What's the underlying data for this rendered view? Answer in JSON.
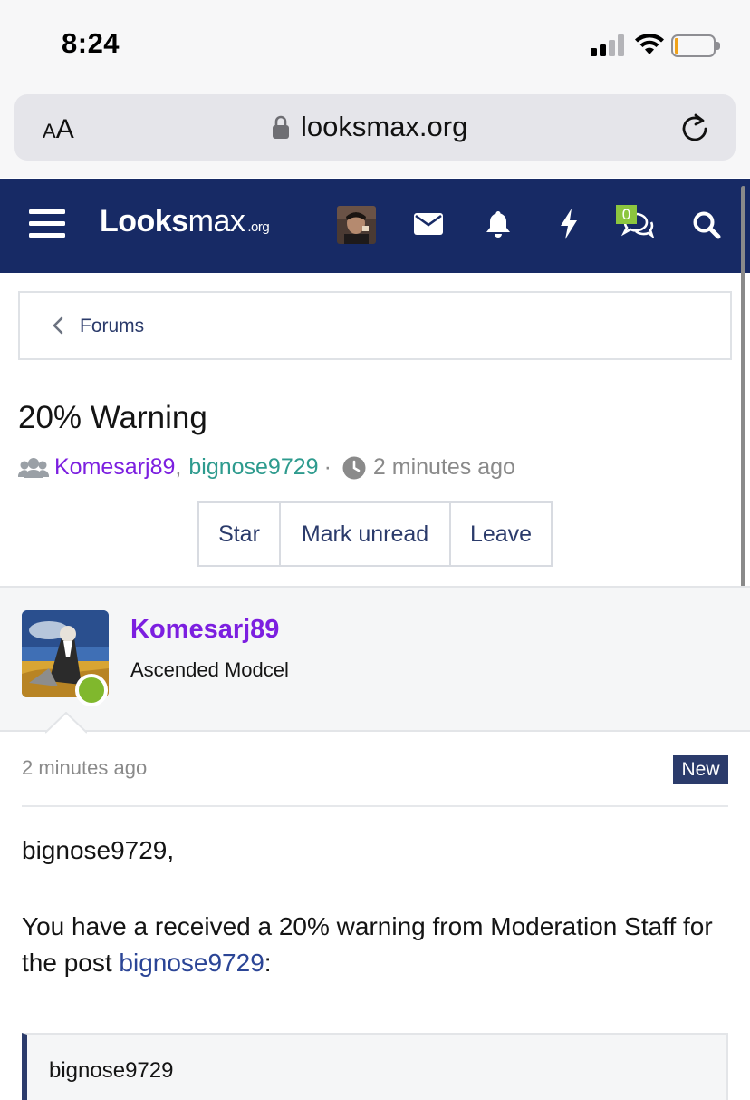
{
  "status_bar": {
    "time": "8:24"
  },
  "browser": {
    "text_size_small": "A",
    "text_size_big": "A",
    "url": "looksmax.org"
  },
  "site_header": {
    "logo_bold": "Looks",
    "logo_max": "max",
    "logo_org": ".org",
    "conversations_count": "0"
  },
  "breadcrumb": {
    "label": "Forums"
  },
  "thread": {
    "title": "20% Warning",
    "participant_1": "Komesarj89",
    "separator_comma": ",",
    "participant_2": "bignose9729",
    "dot": "·",
    "time": "2 minutes ago"
  },
  "actions": [
    {
      "label": "Star"
    },
    {
      "label": "Mark unread"
    },
    {
      "label": "Leave"
    }
  ],
  "message": {
    "author": "Komesarj89",
    "rank": "Ascended Modcel",
    "time": "2 minutes ago",
    "badge": "New",
    "greeting": "bignose9729,",
    "body_prefix": "You have a received a 20% warning from Moderation Staff for the post ",
    "post_link": "bignose9729",
    "body_suffix": ":",
    "quote_author": "bignose9729"
  },
  "colors": {
    "header_bg": "#172a65",
    "link": "#2b3b6b",
    "username_purple": "#7c1fe0",
    "username_teal": "#2e9b8e",
    "online": "#80b82d"
  }
}
